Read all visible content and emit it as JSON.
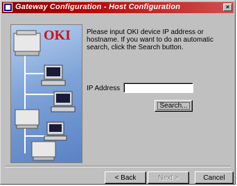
{
  "window": {
    "title": "Gateway Configuration - Host Configuration",
    "close_glyph": "×",
    "title_color": "#b30000"
  },
  "illustration": {
    "logo_text": "OKI",
    "logo_color": "#d01010",
    "background_color": "#7fa3d8"
  },
  "instructions": "Please input OKI device IP address or hostname. If you want to do an automatic search, click the Search button.",
  "ip_field": {
    "label": "IP Address",
    "value": "",
    "placeholder": ""
  },
  "buttons": {
    "search": "Search...",
    "back": "< Back",
    "next": "Next >",
    "cancel": "Cancel"
  }
}
